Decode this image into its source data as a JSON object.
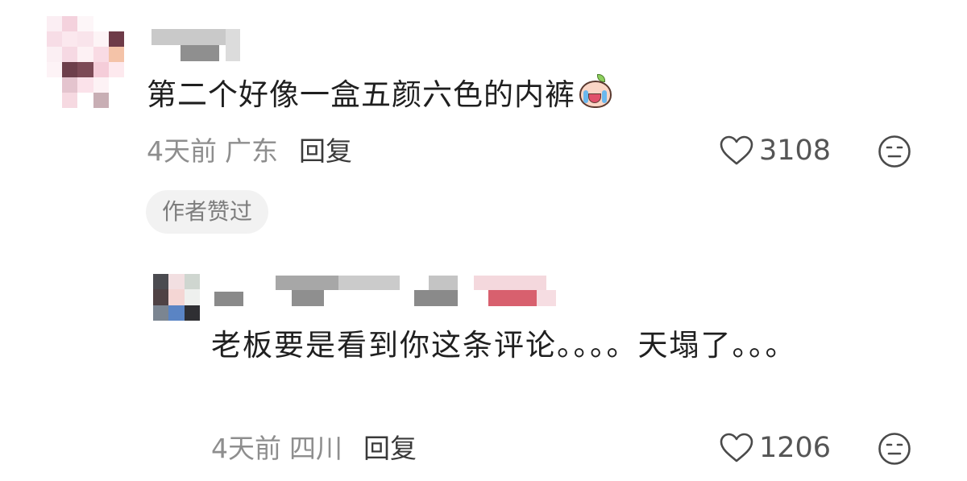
{
  "main_comment": {
    "text": "第二个好像一盒五颜六色的内裤",
    "emoji_icon": "laughing-crying-face-icon",
    "time": "4天前",
    "location": "广东",
    "reply_label": "回复",
    "like_count": "3108",
    "badge": "作者赞过"
  },
  "reply_comment": {
    "text": "老板要是看到你这条评论。。。。天塌了。。。",
    "time": "4天前",
    "location": "四川",
    "reply_label": "回复",
    "like_count": "1206"
  },
  "icons": {
    "like": "heart-outline-icon",
    "dislike": "neutral-face-dislike-icon"
  },
  "colors": {
    "text_primary": "#1f1f1f",
    "text_meta": "#8e8e8e",
    "badge_bg": "#f2f2f2"
  }
}
